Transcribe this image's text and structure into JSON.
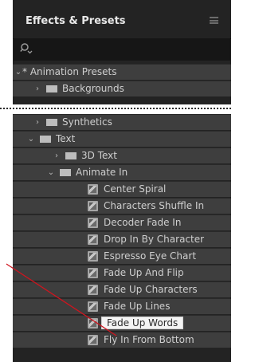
{
  "panel": {
    "title": "Effects & Presets",
    "menu_icon": "hamburger-menu-icon",
    "search": {
      "icon": "search-icon"
    }
  },
  "tree": [
    {
      "label": "* Animation Presets",
      "type": "category",
      "expanded": true
    },
    {
      "label": "Backgrounds",
      "type": "folder",
      "expanded": false
    },
    {
      "label": "Synthetics",
      "type": "folder",
      "expanded": false
    },
    {
      "label": "Text",
      "type": "folder",
      "expanded": true
    },
    {
      "label": "3D Text",
      "type": "folder",
      "expanded": false
    },
    {
      "label": "Animate In",
      "type": "folder",
      "expanded": true
    },
    {
      "label": "Center Spiral",
      "type": "preset"
    },
    {
      "label": "Characters Shuffle In",
      "type": "preset"
    },
    {
      "label": "Decoder Fade In",
      "type": "preset"
    },
    {
      "label": "Drop In By Character",
      "type": "preset"
    },
    {
      "label": "Espresso Eye Chart",
      "type": "preset"
    },
    {
      "label": "Fade Up And Flip",
      "type": "preset"
    },
    {
      "label": "Fade Up Characters",
      "type": "preset"
    },
    {
      "label": "Fade Up Lines",
      "type": "preset"
    },
    {
      "label": "Fade Up Words",
      "type": "preset",
      "selected": true
    },
    {
      "label": "Fly In From Bottom",
      "type": "preset"
    }
  ],
  "colors": {
    "panel_bg": "#232323",
    "row_bg": "#3e3e3e",
    "callout_line": "#d0141e"
  }
}
